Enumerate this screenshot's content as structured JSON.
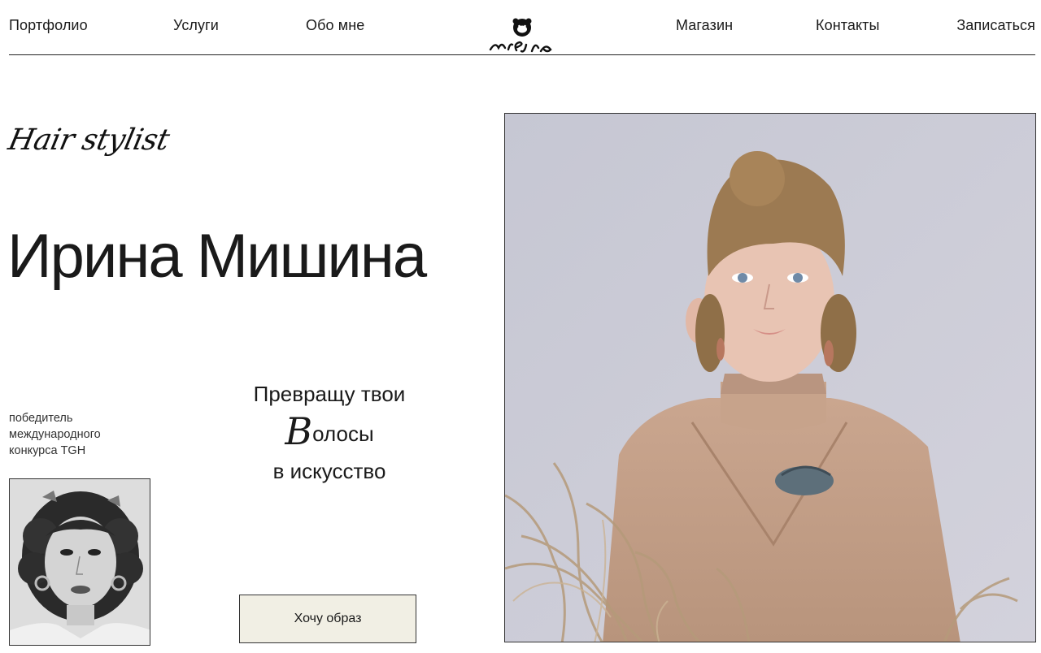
{
  "nav": {
    "portfolio": "Портфолио",
    "services": "Услуги",
    "about": "Обо мне",
    "shop": "Магазин",
    "contacts": "Контакты",
    "book": "Записаться"
  },
  "brand": {
    "logo_text": "misha",
    "logo_icon": "bear-face-icon"
  },
  "hero": {
    "subtitle": "Hair stylist",
    "name": "Ирина Мишина",
    "winner_text": [
      "победитель",
      "международного",
      "конкурса TGH"
    ],
    "tagline_line1": "Превращу твои",
    "tagline_line2_capital": "В",
    "tagline_line2_rest": "олосы",
    "tagline_line3": "в искусство",
    "cta_label": "Хочу образ"
  },
  "colors": {
    "text": "#1a1a1a",
    "button_bg": "#f1efe4",
    "hero_bg": "#c9cad5",
    "dress": "#c4a088"
  }
}
